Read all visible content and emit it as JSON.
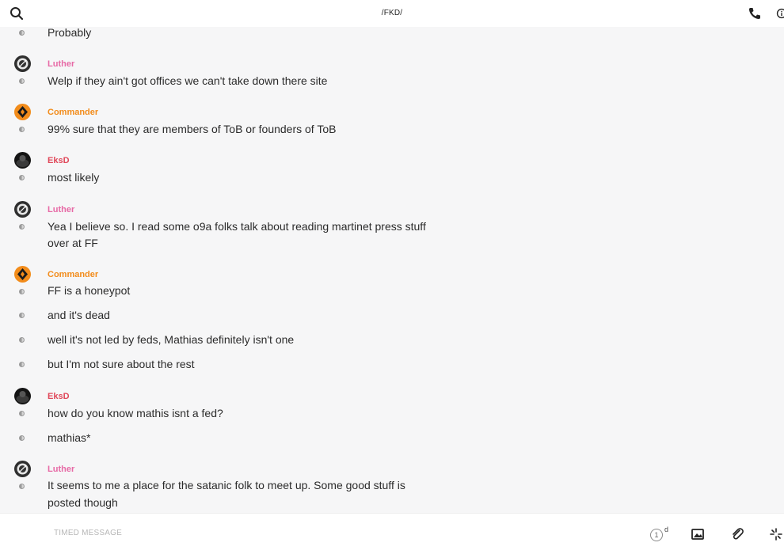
{
  "header": {
    "title": "/FKD/",
    "icons": [
      "search-icon",
      "phone-icon",
      "info-icon"
    ]
  },
  "senders": {
    "luther": {
      "name": "Luther",
      "color": "#e76aa6"
    },
    "commander": {
      "name": "Commander",
      "color": "#f28c1b"
    },
    "eksd": {
      "name": "EksD",
      "color": "#e0485a"
    }
  },
  "messages": [
    {
      "text": "Probably"
    },
    {
      "sender": "Luther",
      "text": "Welp if they ain't got offices we can't take down there site"
    },
    {
      "sender": "Commander",
      "text": "99% sure that they are members of ToB or founders of ToB"
    },
    {
      "sender": "EksD",
      "text": "most likely"
    },
    {
      "sender": "Luther",
      "text": "Yea I believe so. I read some o9a folks talk about reading martinet press stuff",
      "text2": "over at FF"
    },
    {
      "sender": "Commander",
      "text": "FF is a honeypot"
    },
    {
      "text": "and it's dead"
    },
    {
      "text": "well it's not led by feds, Mathias definitely isn't one"
    },
    {
      "text": "but I'm not sure about the rest"
    },
    {
      "sender": "EksD",
      "text": "how do you know mathis isnt a fed?"
    },
    {
      "text": "mathias*"
    },
    {
      "sender": "Luther",
      "text": "It seems to me a place for the satanic folk to meet up. Some good stuff is",
      "text2": "posted though"
    }
  ],
  "composer": {
    "placeholder": "TIMED MESSAGE",
    "timer_value": "1",
    "timer_unit": "d",
    "icons": [
      "image-icon",
      "paperclip-icon",
      "sparkle-icon"
    ]
  }
}
